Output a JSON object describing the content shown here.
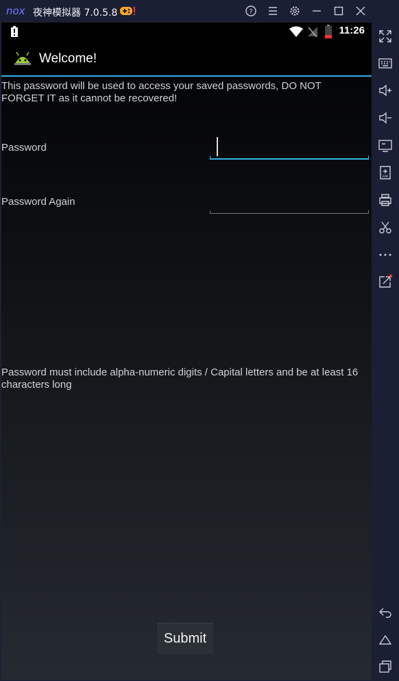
{
  "emulator": {
    "title": "夜神模拟器 7.0.5.8",
    "logo_text": "nox",
    "toolbar_icons": [
      "help-icon",
      "menu-icon",
      "settings-icon",
      "minimize-icon",
      "maximize-icon",
      "close-icon",
      "collapse-sidebar-icon"
    ],
    "sidebar_icons": [
      "fullscreen-icon",
      "keyboard-icon",
      "volume-up-icon",
      "volume-down-icon",
      "screen-icon",
      "add-apk-icon",
      "print-icon",
      "scissors-icon",
      "more-icon",
      "external-link-icon"
    ],
    "nav_icons": [
      "back-icon",
      "home-icon",
      "recents-icon"
    ]
  },
  "status_bar": {
    "time": "11:26"
  },
  "app": {
    "title": "Welcome!",
    "intro": "This password will be used to access your saved passwords, DO NOT FORGET IT as it cannot be recovered!",
    "password_label": "Password",
    "password_again_label": "Password Again",
    "requirement": "Password must include alpha-numeric digits / Capital letters and be at least 16 characters long",
    "submit_label": "Submit"
  },
  "colors": {
    "accent": "#33b5e5",
    "title_bar": "#1b1f33"
  }
}
